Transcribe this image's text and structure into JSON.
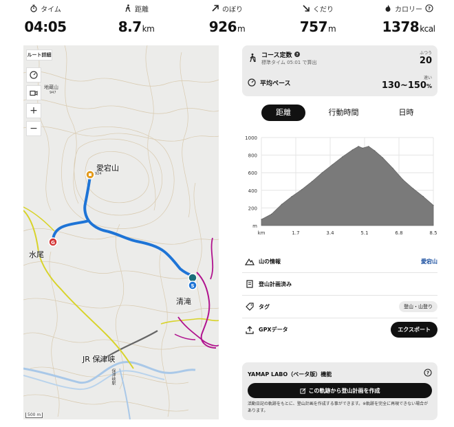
{
  "stats": [
    {
      "label": "タイム",
      "value": "04:05",
      "unit": "",
      "icon": "stopwatch-icon"
    },
    {
      "label": "距離",
      "value": "8.7",
      "unit": "km",
      "icon": "walker-icon"
    },
    {
      "label": "のぼり",
      "value": "926",
      "unit": "m",
      "icon": "arrow-up-right-icon"
    },
    {
      "label": "くだり",
      "value": "757",
      "unit": "m",
      "icon": "arrow-down-right-icon"
    },
    {
      "label": "カロリー",
      "value": "1378",
      "unit": "kcal",
      "icon": "flame-icon"
    }
  ],
  "map": {
    "route_detail": "ルート詳細",
    "summit": "愛宕山",
    "summit_elev": "924",
    "place_mizuo": "水尾",
    "place_kiyotaki": "清滝",
    "station": "JR 保津峡",
    "station_small": "保津峡駅",
    "peak_small": "地蔵山",
    "peak_elev": "947",
    "scale": "500 m",
    "zoom_in": "+",
    "zoom_out": "−",
    "start_marker": "S",
    "goal_marker": "G"
  },
  "course": {
    "title": "コース定数",
    "subtitle": "標準タイム 05:01 で算出",
    "level_label": "ふつう",
    "value": "20",
    "pace_title": "平均ペース",
    "pace_level": "速い",
    "pace_value": "130~150",
    "pace_unit": "%"
  },
  "tabs": [
    "距離",
    "行動時間",
    "日時"
  ],
  "chart_data": {
    "type": "area",
    "x": [
      0,
      0.5,
      1.0,
      1.5,
      2.0,
      2.5,
      3.0,
      3.5,
      4.0,
      4.5,
      4.8,
      5.0,
      5.3,
      5.6,
      6.0,
      6.5,
      7.0,
      7.5,
      8.0,
      8.5
    ],
    "values": [
      70,
      130,
      240,
      330,
      410,
      500,
      600,
      690,
      780,
      860,
      900,
      880,
      900,
      850,
      770,
      650,
      520,
      420,
      330,
      230
    ],
    "ylim": [
      0,
      1000
    ],
    "xlim": [
      0,
      8.5
    ],
    "yticks": [
      "1000",
      "800",
      "600",
      "400",
      "200",
      "m"
    ],
    "xticks": [
      "km",
      "1.7",
      "3.4",
      "5.1",
      "6.8",
      "8.5"
    ],
    "grid": true
  },
  "info": {
    "mountain_label": "山の情報",
    "mountain_value": "愛宕山",
    "plan_label": "登山計画済み",
    "tag_label": "タグ",
    "tag_value": "登山・山登り",
    "gpx_label": "GPXデータ",
    "export_label": "エクスポート"
  },
  "labo": {
    "title": "YAMAP LABO（ベータ版）機能",
    "button": "この軌跡から登山計画を作成",
    "note": "活動日記の軌跡をもとに、登山計画を作成する事ができます。※軌跡を完全に再現できない場合があります。"
  },
  "colors": {
    "route": "#1e74d6",
    "trail_yellow": "#d8d32a",
    "trail_magenta": "#b0138e",
    "chart_fill": "#7a7a7a",
    "link": "#1a4fa0"
  }
}
